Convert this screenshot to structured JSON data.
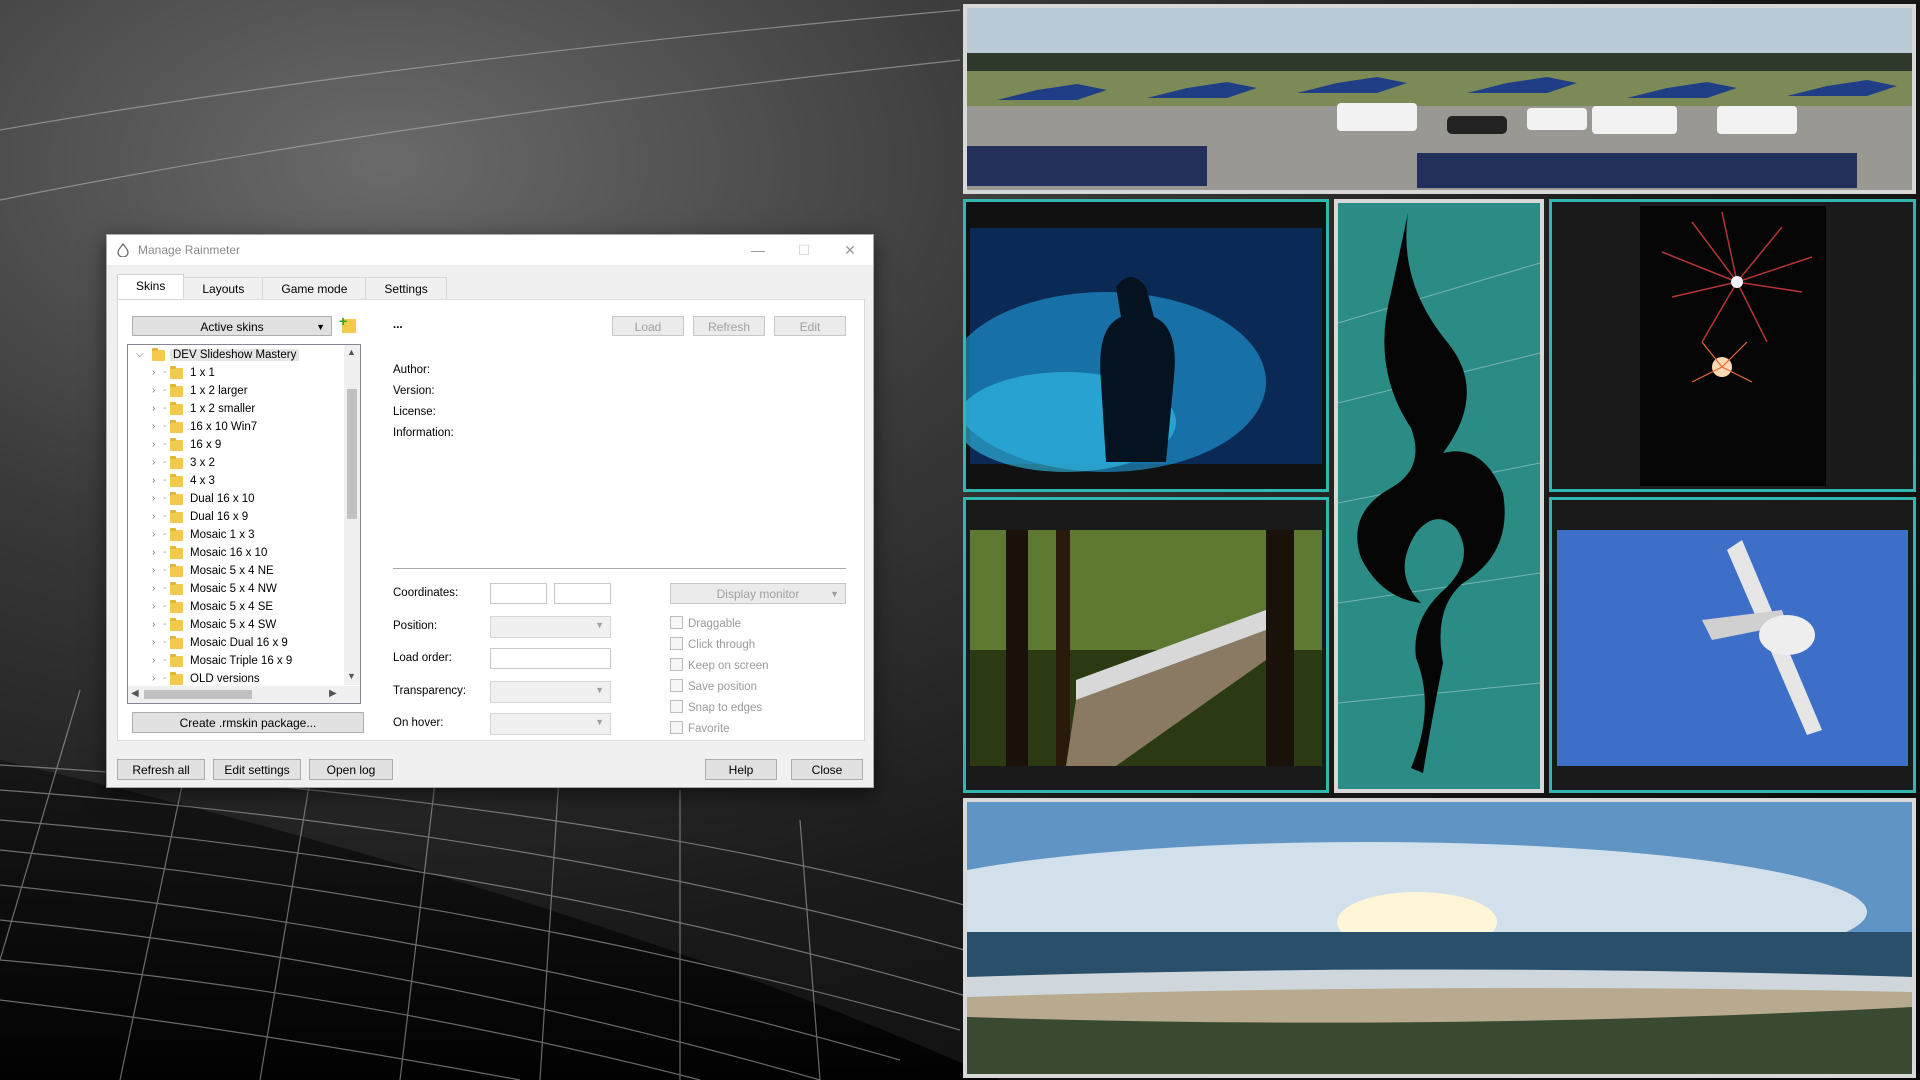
{
  "window": {
    "title": "Manage Rainmeter",
    "caption": {
      "minimize": "—",
      "maximize": "☐",
      "close": "✕"
    }
  },
  "tabs": [
    "Skins",
    "Layouts",
    "Game mode",
    "Settings"
  ],
  "skins_panel": {
    "dropdown": "Active skins",
    "ellipsis": "...",
    "buttons": {
      "load": "Load",
      "refresh": "Refresh",
      "edit": "Edit"
    },
    "tree": {
      "root": "DEV Slideshow Mastery",
      "items": [
        "1 x 1",
        "1 x 2 larger",
        "1 x 2 smaller",
        "16 x 10 Win7",
        "16 x 9",
        "3 x 2",
        "4 x 3",
        "Dual 16 x 10",
        "Dual 16 x 9",
        "Mosaic 1 x 3",
        "Mosaic 16 x 10",
        "Mosaic 5 x 4 NE",
        "Mosaic 5 x 4 NW",
        "Mosaic 5 x 4 SE",
        "Mosaic 5 x 4 SW",
        "Mosaic Dual 16 x 9",
        "Mosaic Triple 16 x 9",
        "OLD versions"
      ]
    },
    "create_package": "Create .rmskin package...",
    "info": {
      "author": "Author:",
      "version": "Version:",
      "license": "License:",
      "information": "Information:"
    },
    "settings": {
      "coordinates": "Coordinates:",
      "position": "Position:",
      "load_order": "Load order:",
      "transparency": "Transparency:",
      "on_hover": "On hover:",
      "display_monitor": "Display monitor"
    },
    "checkboxes": [
      "Draggable",
      "Click through",
      "Keep on screen",
      "Save position",
      "Snap to edges",
      "Favorite"
    ]
  },
  "footer": {
    "refresh_all": "Refresh all",
    "edit_settings": "Edit settings",
    "open_log": "Open log",
    "help": "Help",
    "close": "Close"
  },
  "colors": {
    "tile_border": "#2fb7b0",
    "teal_panel": "#2b8c86",
    "sky": "#3d6fc9"
  }
}
